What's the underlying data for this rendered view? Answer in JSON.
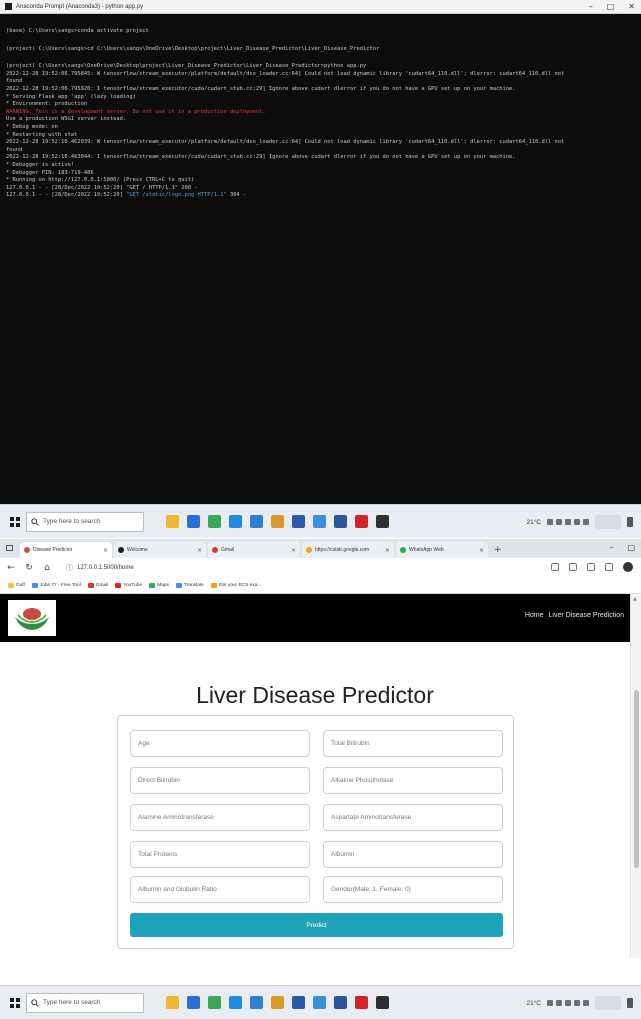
{
  "terminal": {
    "title": "Anaconda Prompt (Anaconda3) - python app.py",
    "window_controls": [
      "–",
      "□",
      "✕"
    ],
    "lines": [
      {
        "text": "(base) C:\\Users\\sangs>conda activate project",
        "style": "gap2"
      },
      {
        "text": "(project) C:\\Users\\sangs>cd C:\\Users\\sangs\\OneDrive\\Desktop\\project\\Liver_Disease_Predictor\\Liver_Disease_Predictor",
        "style": "gap"
      },
      {
        "text": "(project) C:\\Users\\sangs\\OneDrive\\Desktop\\project\\Liver_Disease_Predictor\\Liver_Disease_Predictor>python app.py",
        "style": "gap"
      },
      {
        "text": "2022-12-28 19:52:06.795845: W tensorflow/stream_executor/platform/default/dso_loader.cc:64] Could not load dynamic library 'cudart64_110.dll'; dlerror: cudart64_110.dll not",
        "style": ""
      },
      {
        "text": "found",
        "style": ""
      },
      {
        "text": "2022-12-28 19:52:06.795920: I tensorflow/stream_executor/cuda/cudart_stub.cc:29] Ignore above cudart dlerror if you do not have a GPU set up on your machine.",
        "style": ""
      },
      {
        "text": " * Serving Flask app 'app' (lazy loading)",
        "style": ""
      },
      {
        "text": " * Environment: production",
        "style": ""
      },
      {
        "text": "   WARNING: This is a development server. Do not use it in a production deployment.",
        "style": "red"
      },
      {
        "text": "   Use a production WSGI server instead.",
        "style": ""
      },
      {
        "text": " * Debug mode: on",
        "style": ""
      },
      {
        "text": " * Restarting with stat",
        "style": ""
      },
      {
        "text": "2022-12-28 19:52:10.462039: W tensorflow/stream_executor/platform/default/dso_loader.cc:64] Could not load dynamic library 'cudart64_110.dll'; dlerror: cudart64_110.dll not",
        "style": ""
      },
      {
        "text": "found",
        "style": ""
      },
      {
        "text": "2022-12-28 19:52:10.463044: I tensorflow/stream_executor/cuda/cudart_stub.cc:29] Ignore above cudart dlerror if you do not have a GPU set up on your machine.",
        "style": ""
      },
      {
        "text": " * Debugger is active!",
        "style": ""
      },
      {
        "text": " * Debugger PIN: 183-719-486",
        "style": ""
      },
      {
        "text": " * Running on http://127.0.0.1:5000/ (Press CTRL+C to quit)",
        "style": ""
      },
      {
        "text": "127.0.0.1 - - [28/Dec/2022 19:52:20] \"GET / HTTP/1.1\" 200 -",
        "style": ""
      },
      {
        "text": "127.0.0.1 - - [28/Dec/2022 19:52:20] ",
        "style": "",
        "highlight": "\"GET /static/logo.png HTTP/1.1\"",
        "tail": " 304 -"
      }
    ]
  },
  "taskbar": {
    "search_placeholder": "Type here to search",
    "weather": "21°C",
    "app_icons": [
      {
        "name": "file-explorer-icon",
        "color": "#f2b730"
      },
      {
        "name": "mail-icon",
        "color": "#2b6fd6"
      },
      {
        "name": "chrome-icon",
        "color": "#3aa757"
      },
      {
        "name": "edge-icon",
        "color": "#1f8be0"
      },
      {
        "name": "store-icon",
        "color": "#2d7fd2"
      },
      {
        "name": "files-icon",
        "color": "#d99a2b"
      },
      {
        "name": "settings-icon",
        "color": "#2a5aa8"
      },
      {
        "name": "photos-icon",
        "color": "#3b8fd8"
      },
      {
        "name": "word-icon",
        "color": "#2b579a"
      },
      {
        "name": "opera-icon",
        "color": "#d3242b"
      },
      {
        "name": "terminal-icon",
        "color": "#2f2f2f"
      }
    ],
    "app_icons_2": [
      {
        "name": "file-explorer-icon",
        "color": "#f2b730"
      },
      {
        "name": "mail-icon",
        "color": "#2b6fd6"
      },
      {
        "name": "chrome-icon",
        "color": "#3aa757"
      },
      {
        "name": "edge-icon",
        "color": "#1f8be0"
      },
      {
        "name": "store-icon",
        "color": "#2d7fd2"
      },
      {
        "name": "files-icon",
        "color": "#d99a2b"
      },
      {
        "name": "settings-icon",
        "color": "#2a5aa8"
      },
      {
        "name": "photos-icon",
        "color": "#3b8fd8"
      },
      {
        "name": "word-icon",
        "color": "#2b579a"
      },
      {
        "name": "opera-icon",
        "color": "#d3242b"
      },
      {
        "name": "terminal-icon",
        "color": "#2f2f2f"
      }
    ]
  },
  "browser": {
    "tabs": [
      {
        "title": "Disease Predictor",
        "color": "#d64b3a",
        "active": true
      },
      {
        "title": "Welcome",
        "color": "#1b1b1b",
        "active": false
      },
      {
        "title": "Gmail",
        "color": "#d33c2e",
        "active": false
      },
      {
        "title": "https://colab.google.com",
        "color": "#e8a21e",
        "active": false
      },
      {
        "title": "WhatsApp Web",
        "color": "#25b04a",
        "active": false
      }
    ],
    "new_tab": "+",
    "url": "127.0.0.1:5000/home",
    "bookmarks": [
      {
        "label": "Gulf",
        "color": "#f2c04b"
      },
      {
        "label": "Jobs 77 - Free Tool",
        "color": "#4b8fe0"
      },
      {
        "label": "Gmail",
        "color": "#d33c2e"
      },
      {
        "label": "YouTube",
        "color": "#e62117"
      },
      {
        "label": "Maps",
        "color": "#3aa757"
      },
      {
        "label": "Translate",
        "color": "#4b8fe0"
      },
      {
        "label": "Get your ECS exa...",
        "color": "#e8a21e"
      }
    ]
  },
  "site": {
    "nav": {
      "home": "Home",
      "predictor": "Liver Disease Prediction"
    },
    "title": "Liver Disease Predictor",
    "fields": {
      "age": "Age",
      "total_bilirubin": "Total Bilirubin",
      "direct_bilirubin": "Direct Bilirubin",
      "alkaline_phosphotase": "Alkaline Phosphotase",
      "alamine_aminotransferase": "Alamine Aminotransferase",
      "aspartate_aminotransferase": "Aspartate Aminotransferase",
      "total_proteins": "Total Proteins",
      "albumin": "Albumin",
      "albumin_globulin_ratio": "Albumin and Globulin Ratio",
      "gender": "Gender(Male: 1, Female: 0)"
    },
    "predict_button": "Predict"
  }
}
